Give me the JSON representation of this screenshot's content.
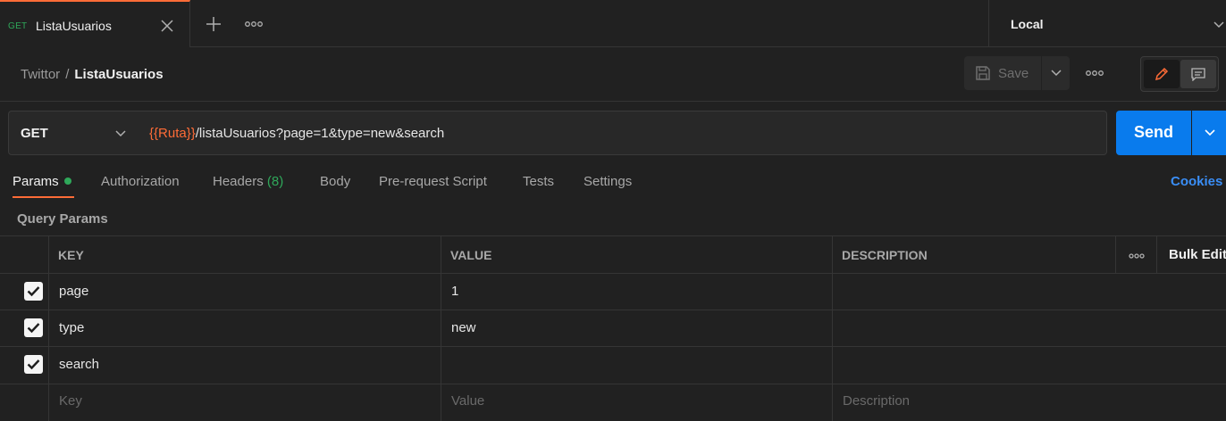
{
  "tabs": [
    {
      "method": "GET",
      "title": "ListaUsuarios"
    }
  ],
  "environment": {
    "selected": "Local"
  },
  "breadcrumb": {
    "parent": "Twittor",
    "separator": "/",
    "current": "ListaUsuarios"
  },
  "toolbar": {
    "save_label": "Save"
  },
  "request": {
    "method": "GET",
    "url_variable": "{{Ruta}}",
    "url_path": "/listaUsuarios?page=1&type=new&search",
    "send_label": "Send"
  },
  "request_tabs": {
    "params": "Params",
    "authorization": "Authorization",
    "headers": "Headers",
    "headers_count": "(8)",
    "body": "Body",
    "pre_request": "Pre-request Script",
    "tests": "Tests",
    "settings": "Settings",
    "cookies": "Cookies"
  },
  "query_params": {
    "title": "Query Params",
    "columns": {
      "key": "KEY",
      "value": "VALUE",
      "description": "DESCRIPTION",
      "bulk_edit": "Bulk Edit"
    },
    "rows": [
      {
        "checked": true,
        "key": "page",
        "value": "1",
        "description": ""
      },
      {
        "checked": true,
        "key": "type",
        "value": "new",
        "description": ""
      },
      {
        "checked": true,
        "key": "search",
        "value": "",
        "description": ""
      }
    ],
    "placeholders": {
      "key": "Key",
      "value": "Value",
      "description": "Description"
    }
  },
  "colors": {
    "accent": "#ff6c37",
    "send": "#097bed",
    "get_method": "#2fa85a",
    "link": "#3a8ef6"
  },
  "icons": [
    "close-icon",
    "plus-icon",
    "more-icon",
    "chevron-down-icon",
    "save-icon",
    "pencil-icon",
    "comment-icon",
    "check-icon"
  ]
}
